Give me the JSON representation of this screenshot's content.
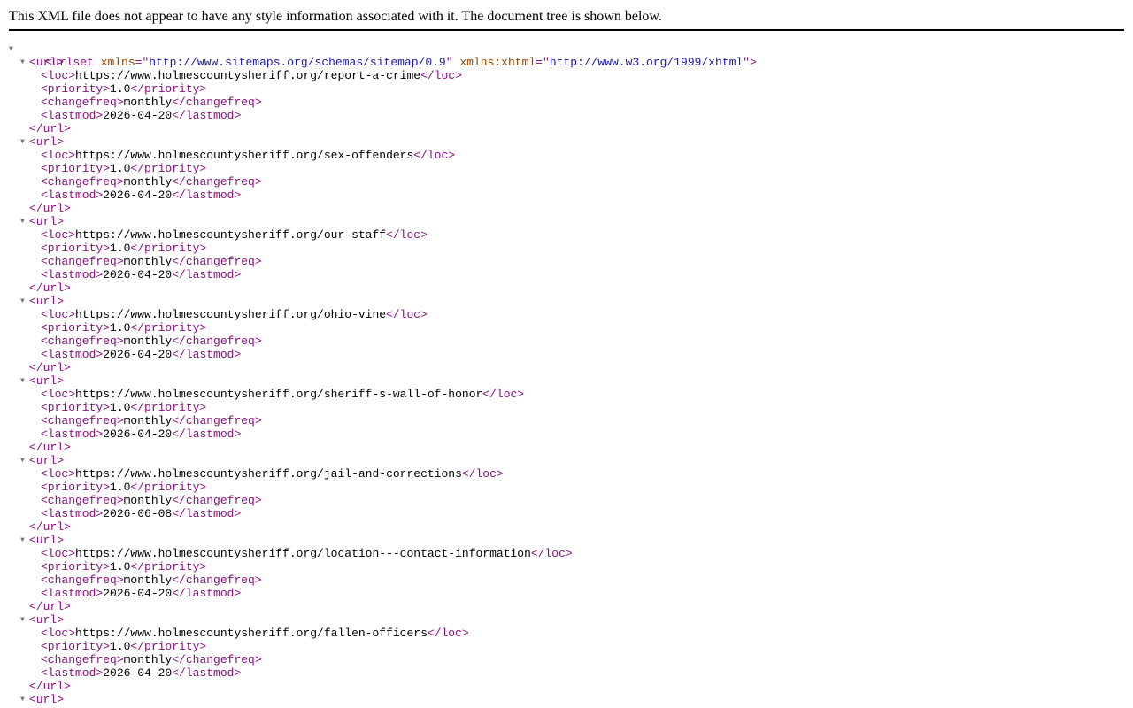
{
  "header": {
    "notice": "This XML file does not appear to have any style information associated with it. The document tree is shown below."
  },
  "colors": {
    "tag": "#881280",
    "attribute_name": "#994500",
    "attribute_value": "#1a1aa6",
    "text": "#000000",
    "toggle": "#777777"
  },
  "icons": {
    "toggle": "collapse-triangle-icon"
  },
  "root": {
    "tag": "urlset",
    "attributes": [
      {
        "name": "xmlns",
        "value": "http://www.sitemaps.org/schemas/sitemap/0.9"
      },
      {
        "name": "xmlns:xhtml",
        "value": "http://www.w3.org/1999/xhtml"
      }
    ]
  },
  "urls": [
    {
      "loc": "https://www.holmescountysheriff.org/report-a-crime",
      "priority": "1.0",
      "changefreq": "monthly",
      "lastmod": "2026-04-20"
    },
    {
      "loc": "https://www.holmescountysheriff.org/sex-offenders",
      "priority": "1.0",
      "changefreq": "monthly",
      "lastmod": "2026-04-20"
    },
    {
      "loc": "https://www.holmescountysheriff.org/our-staff",
      "priority": "1.0",
      "changefreq": "monthly",
      "lastmod": "2026-04-20"
    },
    {
      "loc": "https://www.holmescountysheriff.org/ohio-vine",
      "priority": "1.0",
      "changefreq": "monthly",
      "lastmod": "2026-04-20"
    },
    {
      "loc": "https://www.holmescountysheriff.org/sheriff-s-wall-of-honor",
      "priority": "1.0",
      "changefreq": "monthly",
      "lastmod": "2026-04-20"
    },
    {
      "loc": "https://www.holmescountysheriff.org/jail-and-corrections",
      "priority": "1.0",
      "changefreq": "monthly",
      "lastmod": "2026-06-08"
    },
    {
      "loc": "https://www.holmescountysheriff.org/location---contact-information",
      "priority": "1.0",
      "changefreq": "monthly",
      "lastmod": "2026-04-20"
    },
    {
      "loc": "https://www.holmescountysheriff.org/fallen-officers",
      "priority": "1.0",
      "changefreq": "monthly",
      "lastmod": "2026-04-20"
    }
  ],
  "trailing_url_open": true
}
